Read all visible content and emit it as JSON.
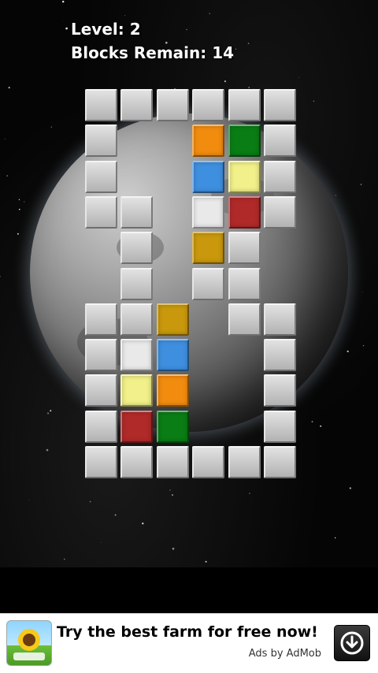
{
  "hud": {
    "level_label": "Level: 2",
    "blocks_label": "Blocks Remain: 14"
  },
  "board": {
    "cols": 6,
    "rows": 11,
    "colors": {
      "wall": "#c8c8c8",
      "orange": "#f28c0f",
      "green": "#0a7d15",
      "blue": "#3f8fe0",
      "yellow": "#f1f08a",
      "white": "#e9e9e9",
      "red": "#b02a2a",
      "gold": "#c9980c"
    },
    "walls": [
      [
        0,
        0
      ],
      [
        1,
        0
      ],
      [
        2,
        0
      ],
      [
        3,
        0
      ],
      [
        4,
        0
      ],
      [
        5,
        0
      ],
      [
        0,
        1
      ],
      [
        5,
        1
      ],
      [
        0,
        2
      ],
      [
        5,
        2
      ],
      [
        0,
        3
      ],
      [
        1,
        3
      ],
      [
        5,
        3
      ],
      [
        1,
        4
      ],
      [
        4,
        4
      ],
      [
        1,
        5
      ],
      [
        3,
        5
      ],
      [
        4,
        5
      ],
      [
        0,
        6
      ],
      [
        1,
        6
      ],
      [
        4,
        6
      ],
      [
        5,
        6
      ],
      [
        0,
        7
      ],
      [
        5,
        7
      ],
      [
        0,
        8
      ],
      [
        5,
        8
      ],
      [
        0,
        9
      ],
      [
        5,
        9
      ],
      [
        0,
        10
      ],
      [
        1,
        10
      ],
      [
        2,
        10
      ],
      [
        3,
        10
      ],
      [
        4,
        10
      ],
      [
        5,
        10
      ]
    ],
    "blocks": [
      {
        "col": 3,
        "row": 1,
        "color": "orange"
      },
      {
        "col": 4,
        "row": 1,
        "color": "green"
      },
      {
        "col": 3,
        "row": 2,
        "color": "blue"
      },
      {
        "col": 4,
        "row": 2,
        "color": "yellow"
      },
      {
        "col": 3,
        "row": 3,
        "color": "white"
      },
      {
        "col": 4,
        "row": 3,
        "color": "red"
      },
      {
        "col": 3,
        "row": 4,
        "color": "gold"
      },
      {
        "col": 2,
        "row": 6,
        "color": "gold"
      },
      {
        "col": 1,
        "row": 7,
        "color": "white"
      },
      {
        "col": 2,
        "row": 7,
        "color": "blue"
      },
      {
        "col": 1,
        "row": 8,
        "color": "yellow"
      },
      {
        "col": 2,
        "row": 8,
        "color": "orange"
      },
      {
        "col": 1,
        "row": 9,
        "color": "red"
      },
      {
        "col": 2,
        "row": 9,
        "color": "green"
      }
    ]
  },
  "ad": {
    "headline": "Try the best farm for free now!",
    "credit": "Ads by AdMob",
    "icon": "sunflower-farm-icon",
    "action_icon": "download-icon"
  }
}
